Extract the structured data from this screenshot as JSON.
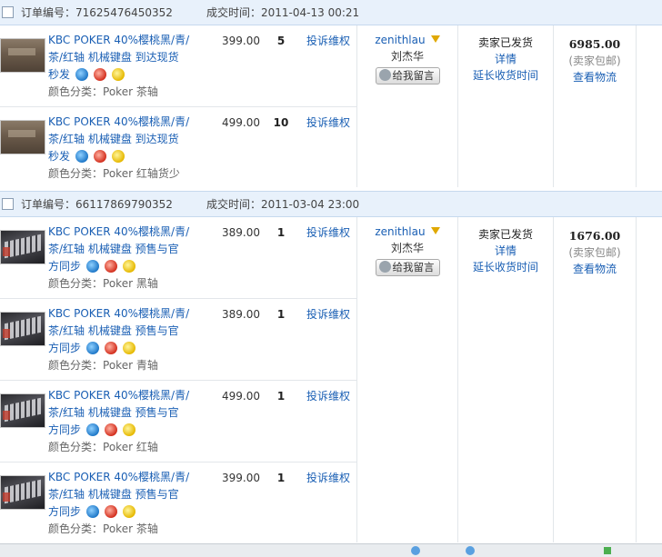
{
  "labels": {
    "order_no_label": "订单编号：",
    "deal_time_label": "成交时间：",
    "class_prefix": "颜色分类：",
    "complain": "投诉维权",
    "leave_message": "给我留言",
    "status_shipped": "卖家已发货",
    "detail": "详情",
    "extend_receipt": "延长收货时间",
    "free_shipping": "(卖家包邮)",
    "view_logistics": "查看物流"
  },
  "orders": [
    {
      "order_no": "71625476450352",
      "deal_time": "2011-04-13 00:21",
      "seller_nick": "zenithlau",
      "seller_name": "刘杰华",
      "total": "6985.00",
      "items": [
        {
          "title_lines": [
            "KBC POKER 40%樱桃黑/青/",
            "茶/红轴 机械键盘 到达现货",
            "秒发"
          ],
          "category": "Poker 茶轴",
          "price": "399.00",
          "qty": "5",
          "thumb": "box"
        },
        {
          "title_lines": [
            "KBC POKER 40%樱桃黑/青/",
            "茶/红轴 机械键盘 到达现货",
            "秒发"
          ],
          "category": "Poker 红轴货少",
          "price": "499.00",
          "qty": "10",
          "thumb": "box"
        }
      ]
    },
    {
      "order_no": "66117869790352",
      "deal_time": "2011-03-04 23:00",
      "seller_nick": "zenithlau",
      "seller_name": "刘杰华",
      "total": "1676.00",
      "items": [
        {
          "title_lines": [
            "KBC POKER 40%樱桃黑/青/",
            "茶/红轴 机械键盘 预售与官",
            "方同步"
          ],
          "category": "Poker 黑轴",
          "price": "389.00",
          "qty": "1",
          "thumb": "kb"
        },
        {
          "title_lines": [
            "KBC POKER 40%樱桃黑/青/",
            "茶/红轴 机械键盘 预售与官",
            "方同步"
          ],
          "category": "Poker 青轴",
          "price": "389.00",
          "qty": "1",
          "thumb": "kb"
        },
        {
          "title_lines": [
            "KBC POKER 40%樱桃黑/青/",
            "茶/红轴 机械键盘 预售与官",
            "方同步"
          ],
          "category": "Poker 红轴",
          "price": "499.00",
          "qty": "1",
          "thumb": "kb"
        },
        {
          "title_lines": [
            "KBC POKER 40%樱桃黑/青/",
            "茶/红轴 机械键盘 预售与官",
            "方同步"
          ],
          "category": "Poker 茶轴",
          "price": "399.00",
          "qty": "1",
          "thumb": "kb"
        }
      ]
    }
  ],
  "icons": [
    "bao-icon",
    "seven-day-return-icon",
    "credit-badge-icon"
  ]
}
